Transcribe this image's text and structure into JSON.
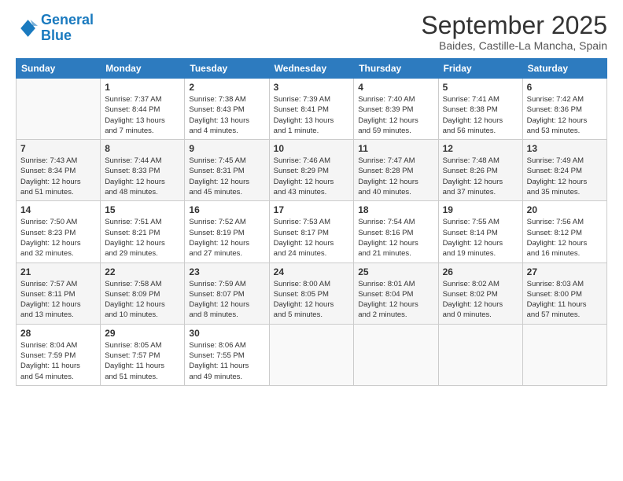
{
  "logo": {
    "line1": "General",
    "line2": "Blue"
  },
  "title": "September 2025",
  "location": "Baides, Castille-La Mancha, Spain",
  "days_of_week": [
    "Sunday",
    "Monday",
    "Tuesday",
    "Wednesday",
    "Thursday",
    "Friday",
    "Saturday"
  ],
  "weeks": [
    [
      {
        "day": "",
        "info": ""
      },
      {
        "day": "1",
        "info": "Sunrise: 7:37 AM\nSunset: 8:44 PM\nDaylight: 13 hours\nand 7 minutes."
      },
      {
        "day": "2",
        "info": "Sunrise: 7:38 AM\nSunset: 8:43 PM\nDaylight: 13 hours\nand 4 minutes."
      },
      {
        "day": "3",
        "info": "Sunrise: 7:39 AM\nSunset: 8:41 PM\nDaylight: 13 hours\nand 1 minute."
      },
      {
        "day": "4",
        "info": "Sunrise: 7:40 AM\nSunset: 8:39 PM\nDaylight: 12 hours\nand 59 minutes."
      },
      {
        "day": "5",
        "info": "Sunrise: 7:41 AM\nSunset: 8:38 PM\nDaylight: 12 hours\nand 56 minutes."
      },
      {
        "day": "6",
        "info": "Sunrise: 7:42 AM\nSunset: 8:36 PM\nDaylight: 12 hours\nand 53 minutes."
      }
    ],
    [
      {
        "day": "7",
        "info": "Sunrise: 7:43 AM\nSunset: 8:34 PM\nDaylight: 12 hours\nand 51 minutes."
      },
      {
        "day": "8",
        "info": "Sunrise: 7:44 AM\nSunset: 8:33 PM\nDaylight: 12 hours\nand 48 minutes."
      },
      {
        "day": "9",
        "info": "Sunrise: 7:45 AM\nSunset: 8:31 PM\nDaylight: 12 hours\nand 45 minutes."
      },
      {
        "day": "10",
        "info": "Sunrise: 7:46 AM\nSunset: 8:29 PM\nDaylight: 12 hours\nand 43 minutes."
      },
      {
        "day": "11",
        "info": "Sunrise: 7:47 AM\nSunset: 8:28 PM\nDaylight: 12 hours\nand 40 minutes."
      },
      {
        "day": "12",
        "info": "Sunrise: 7:48 AM\nSunset: 8:26 PM\nDaylight: 12 hours\nand 37 minutes."
      },
      {
        "day": "13",
        "info": "Sunrise: 7:49 AM\nSunset: 8:24 PM\nDaylight: 12 hours\nand 35 minutes."
      }
    ],
    [
      {
        "day": "14",
        "info": "Sunrise: 7:50 AM\nSunset: 8:23 PM\nDaylight: 12 hours\nand 32 minutes."
      },
      {
        "day": "15",
        "info": "Sunrise: 7:51 AM\nSunset: 8:21 PM\nDaylight: 12 hours\nand 29 minutes."
      },
      {
        "day": "16",
        "info": "Sunrise: 7:52 AM\nSunset: 8:19 PM\nDaylight: 12 hours\nand 27 minutes."
      },
      {
        "day": "17",
        "info": "Sunrise: 7:53 AM\nSunset: 8:17 PM\nDaylight: 12 hours\nand 24 minutes."
      },
      {
        "day": "18",
        "info": "Sunrise: 7:54 AM\nSunset: 8:16 PM\nDaylight: 12 hours\nand 21 minutes."
      },
      {
        "day": "19",
        "info": "Sunrise: 7:55 AM\nSunset: 8:14 PM\nDaylight: 12 hours\nand 19 minutes."
      },
      {
        "day": "20",
        "info": "Sunrise: 7:56 AM\nSunset: 8:12 PM\nDaylight: 12 hours\nand 16 minutes."
      }
    ],
    [
      {
        "day": "21",
        "info": "Sunrise: 7:57 AM\nSunset: 8:11 PM\nDaylight: 12 hours\nand 13 minutes."
      },
      {
        "day": "22",
        "info": "Sunrise: 7:58 AM\nSunset: 8:09 PM\nDaylight: 12 hours\nand 10 minutes."
      },
      {
        "day": "23",
        "info": "Sunrise: 7:59 AM\nSunset: 8:07 PM\nDaylight: 12 hours\nand 8 minutes."
      },
      {
        "day": "24",
        "info": "Sunrise: 8:00 AM\nSunset: 8:05 PM\nDaylight: 12 hours\nand 5 minutes."
      },
      {
        "day": "25",
        "info": "Sunrise: 8:01 AM\nSunset: 8:04 PM\nDaylight: 12 hours\nand 2 minutes."
      },
      {
        "day": "26",
        "info": "Sunrise: 8:02 AM\nSunset: 8:02 PM\nDaylight: 12 hours\nand 0 minutes."
      },
      {
        "day": "27",
        "info": "Sunrise: 8:03 AM\nSunset: 8:00 PM\nDaylight: 11 hours\nand 57 minutes."
      }
    ],
    [
      {
        "day": "28",
        "info": "Sunrise: 8:04 AM\nSunset: 7:59 PM\nDaylight: 11 hours\nand 54 minutes."
      },
      {
        "day": "29",
        "info": "Sunrise: 8:05 AM\nSunset: 7:57 PM\nDaylight: 11 hours\nand 51 minutes."
      },
      {
        "day": "30",
        "info": "Sunrise: 8:06 AM\nSunset: 7:55 PM\nDaylight: 11 hours\nand 49 minutes."
      },
      {
        "day": "",
        "info": ""
      },
      {
        "day": "",
        "info": ""
      },
      {
        "day": "",
        "info": ""
      },
      {
        "day": "",
        "info": ""
      }
    ]
  ]
}
